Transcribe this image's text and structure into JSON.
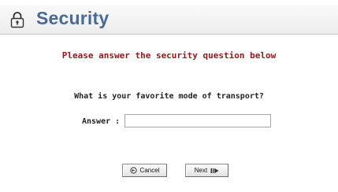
{
  "header": {
    "title": "Security",
    "icon": "lock-icon"
  },
  "main": {
    "instruction": "Please answer the security question below",
    "question": "What is your favorite mode of transport?",
    "answer_label": "Answer :",
    "answer_value": ""
  },
  "buttons": {
    "cancel_label": "Cancel",
    "cancel_icon": "cancel-icon",
    "next_label": "Next",
    "next_icon": "next-arrow-icon"
  },
  "colors": {
    "title": "#4a6a95",
    "instruction": "#8b1a1a"
  }
}
